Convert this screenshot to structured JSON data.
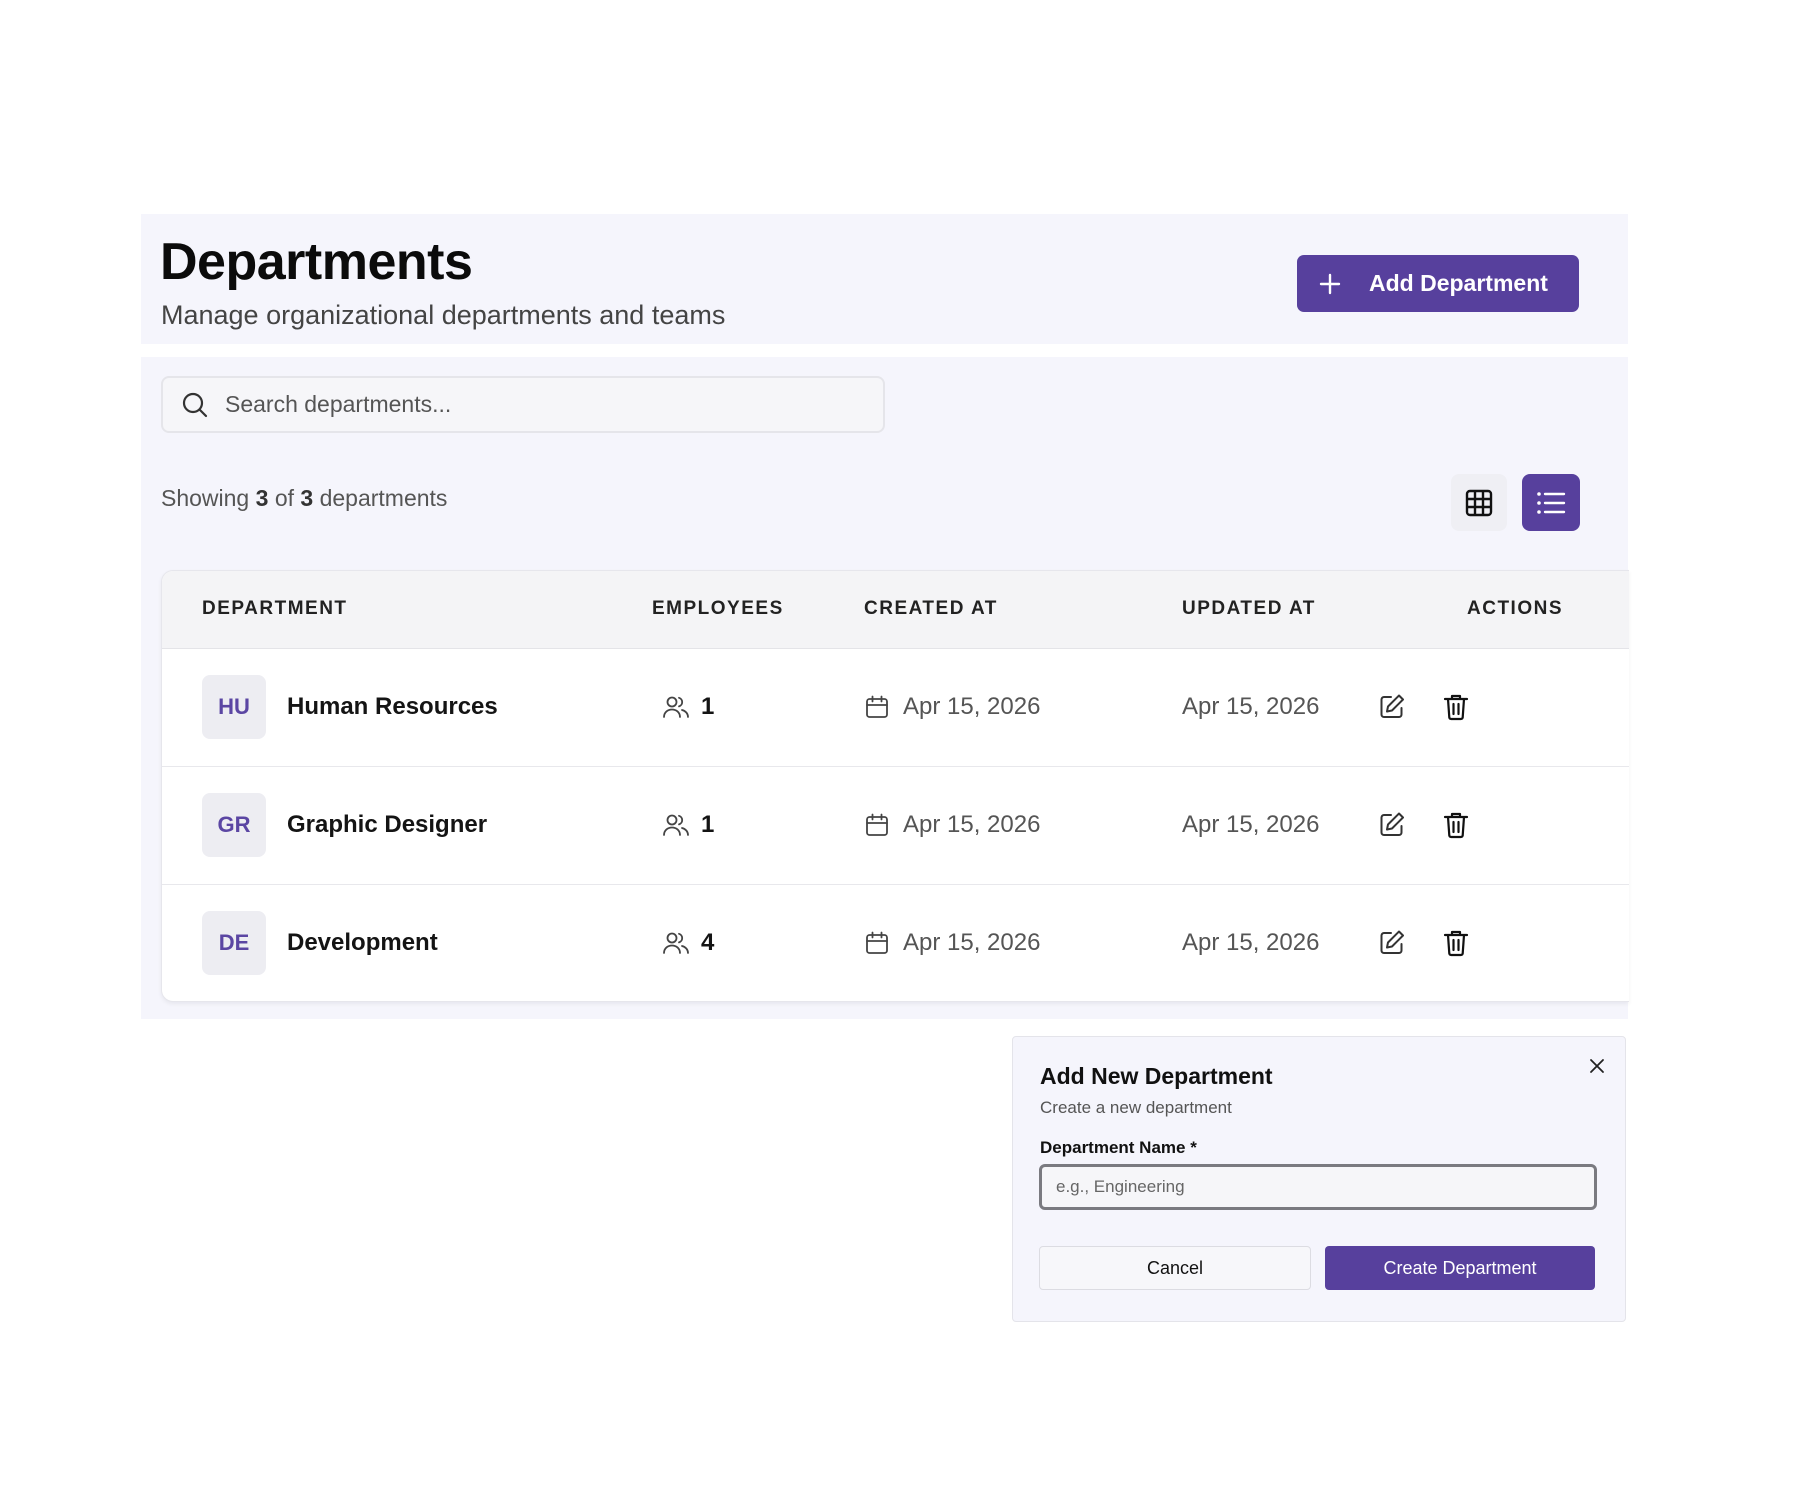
{
  "header": {
    "title": "Departments",
    "subtitle": "Manage organizational departments and teams",
    "add_button_label": "Add Department"
  },
  "search": {
    "placeholder": "Search departments..."
  },
  "summary": {
    "prefix": "Showing",
    "shown": "3",
    "of": "of",
    "total": "3",
    "suffix": "departments"
  },
  "view_toggle": {
    "grid_icon": "grid-view-icon",
    "list_icon": "list-view-icon",
    "active": "list"
  },
  "table": {
    "columns": [
      "DEPARTMENT",
      "EMPLOYEES",
      "CREATED AT",
      "UPDATED AT",
      "ACTIONS"
    ],
    "rows": [
      {
        "initials": "HU",
        "name": "Human Resources",
        "employees": "1",
        "created": "Apr 15, 2026",
        "updated": "Apr 15, 2026"
      },
      {
        "initials": "GR",
        "name": "Graphic Designer",
        "employees": "1",
        "created": "Apr 15, 2026",
        "updated": "Apr 15, 2026"
      },
      {
        "initials": "DE",
        "name": "Development",
        "employees": "4",
        "created": "Apr 15, 2026",
        "updated": "Apr 15, 2026"
      }
    ]
  },
  "dialog": {
    "title": "Add New Department",
    "description": "Create a new department",
    "field_label": "Department Name *",
    "field_placeholder": "e.g., Engineering",
    "field_value": "",
    "cancel_label": "Cancel",
    "create_label": "Create Department"
  },
  "colors": {
    "accent": "#57409d",
    "panel_bg": "#f5f5fc",
    "avatar_text": "#5b46a3"
  }
}
